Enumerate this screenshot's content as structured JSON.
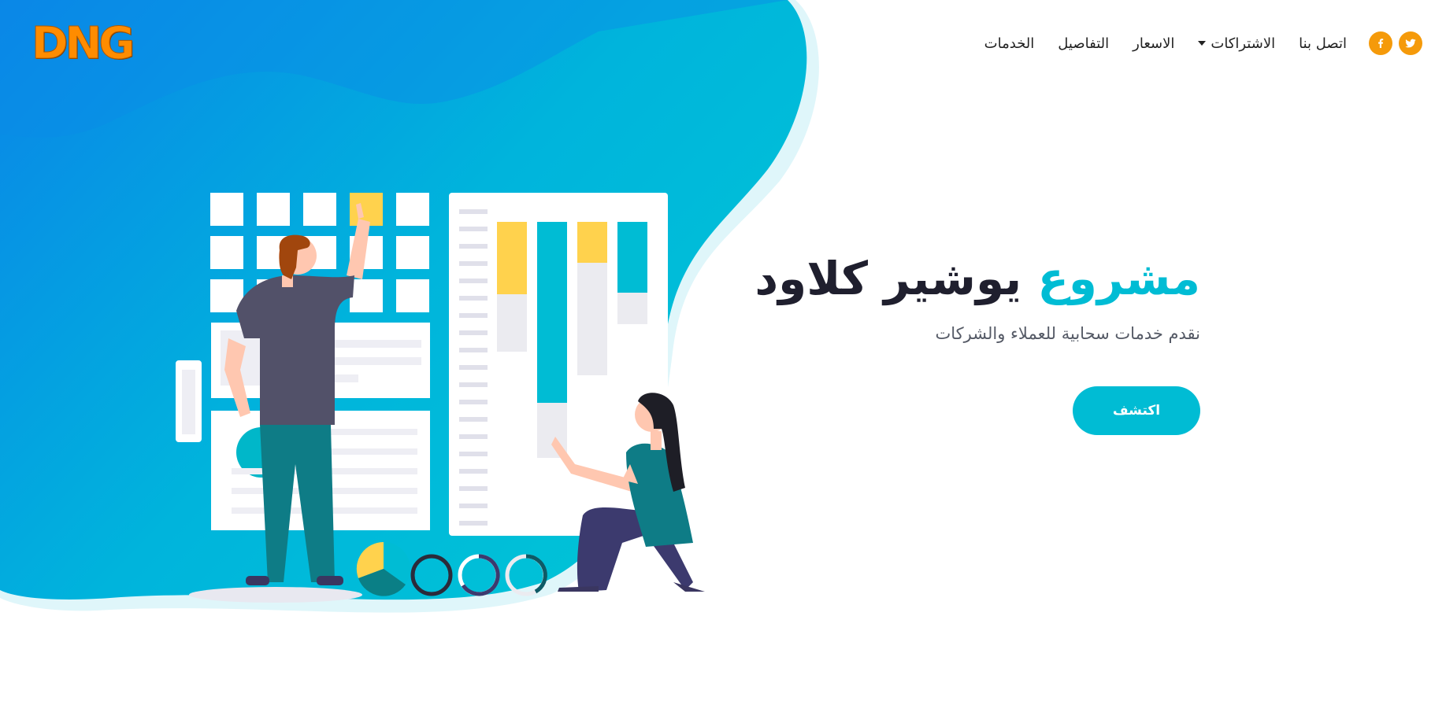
{
  "logo": {
    "text": "DNG"
  },
  "nav": {
    "items": [
      {
        "label": "الخدمات"
      },
      {
        "label": "التفاصيل"
      },
      {
        "label": "الاسعار"
      },
      {
        "label": "الاشتراكات",
        "dropdown": true
      },
      {
        "label": "اتصل بنا"
      }
    ],
    "social": [
      {
        "icon": "twitter-icon"
      },
      {
        "icon": "facebook-icon"
      }
    ]
  },
  "hero": {
    "title_accent": "مشروع",
    "title_rest": "يوشير كلاود",
    "subtitle": "نقدم خدمات سحابية للعملاء والشركات",
    "cta_label": "اكتشف"
  },
  "colors": {
    "accent": "#00bcd4",
    "blue": "#0a8de6",
    "orange": "#f59a0a",
    "yellow": "#ffd24d",
    "dark_text": "#1f1f2e"
  }
}
